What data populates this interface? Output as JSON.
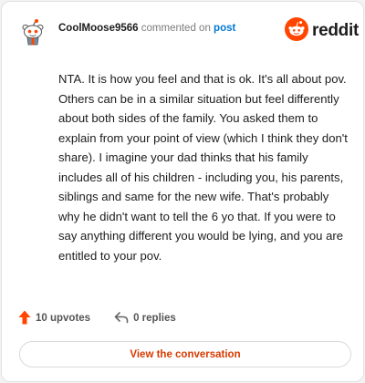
{
  "comment": {
    "username": "CoolMoose9566",
    "verb": "commented on",
    "target": "post",
    "body": "NTA. It is how you feel and that is ok. It's all about pov. Others can be in a similar situation but feel differently about both sides of the family. You asked them to explain from your point of view (which I think they don't share). I imagine your dad thinks that his family includes all of his children - including you, his parents, siblings and same for the new wife. That's probably why he didn't want to tell the 6 yo that. If you were to say anything different you would be lying, and you are entitled to your pov."
  },
  "brand": {
    "wordmark": "reddit",
    "color": "#ff4500"
  },
  "actions": {
    "upvotes_label": "10 upvotes",
    "replies_label": "0 replies"
  },
  "cta": {
    "label": "View the conversation"
  },
  "icons": {
    "avatar": "snoo-avatar-icon",
    "logo": "reddit-logo-icon",
    "upvote": "upvote-arrow-icon",
    "reply": "reply-arrow-icon"
  }
}
